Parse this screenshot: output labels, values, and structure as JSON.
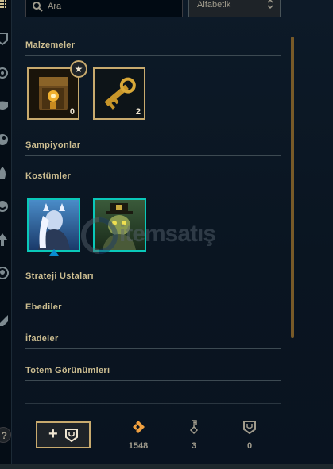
{
  "search": {
    "placeholder": "Ara"
  },
  "sort": {
    "selected": "Alfabetik",
    "icon": "chevron-up-down-icon"
  },
  "sections": {
    "materials": "Malzemeler",
    "champions": "Şampiyonlar",
    "skins": "Kostümler",
    "tft": "Strateji Ustaları",
    "eternals": "Ebediler",
    "emotes": "İfadeler",
    "totems": "Totem Görünümleri"
  },
  "materials": [
    {
      "name": "chest",
      "count": "0",
      "icon": "hextech-chest-icon"
    },
    {
      "name": "key",
      "count": "2",
      "icon": "hextech-key-icon"
    }
  ],
  "watermark": {
    "text": "itemsatış"
  },
  "currencies": [
    {
      "icon": "orange-essence-icon",
      "value": "1548"
    },
    {
      "icon": "key-fragment-icon",
      "value": "3"
    },
    {
      "icon": "chest-capacity-icon",
      "value": "0"
    }
  ],
  "help": {
    "label": "?"
  },
  "colors": {
    "gold": "#c8aa6e",
    "teal": "#0ac8b9",
    "background": "#0a1521",
    "orange_essence": "#f0a040"
  }
}
